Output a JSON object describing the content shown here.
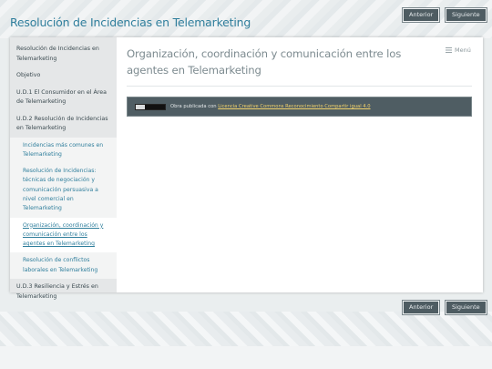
{
  "site": {
    "title": "Resolución de Incidencias en Telemarketing"
  },
  "nav": {
    "prev_label": "Anterior",
    "next_label": "Siguiente"
  },
  "sidebar": {
    "items": [
      {
        "label": "Resolución de Incidencias en Telemarketing"
      },
      {
        "label": "Objetivo"
      },
      {
        "label": "U.D.1 El Consumidor en el Área de Telemarketing"
      },
      {
        "label": "U.D.2 Resolución de Incidencias en Telemarketing"
      }
    ],
    "subitems": [
      {
        "label": "Incidencias más comunes en Telemarketing",
        "active": false
      },
      {
        "label": "Resolución de Incidencias: técnicas de negociación y comunicación persuasiva a nivel comercial en Telemarketing",
        "active": false
      },
      {
        "label": "Organización, coordinación y comunicación entre los agentes en Telemarketing",
        "active": true
      },
      {
        "label": "Resolución de conflictos laborales en Telemarketing",
        "active": false
      }
    ],
    "last_item": {
      "label": "U.D.3 Resiliencia y Estrés en Telemarketing"
    }
  },
  "main": {
    "title": "Organización, coordinación y comunicación entre los agentes en Telemarketing",
    "menu_label": "Menú"
  },
  "license": {
    "text": "Obra publicada con ",
    "link_text": "Licencia Creative Commons Reconocimiento Compartir igual 4.0"
  },
  "colors": {
    "accent": "#2f7e9c",
    "button_bg": "#4e5c62",
    "license_bar": "#4f5d63",
    "link": "#f3d36b"
  }
}
